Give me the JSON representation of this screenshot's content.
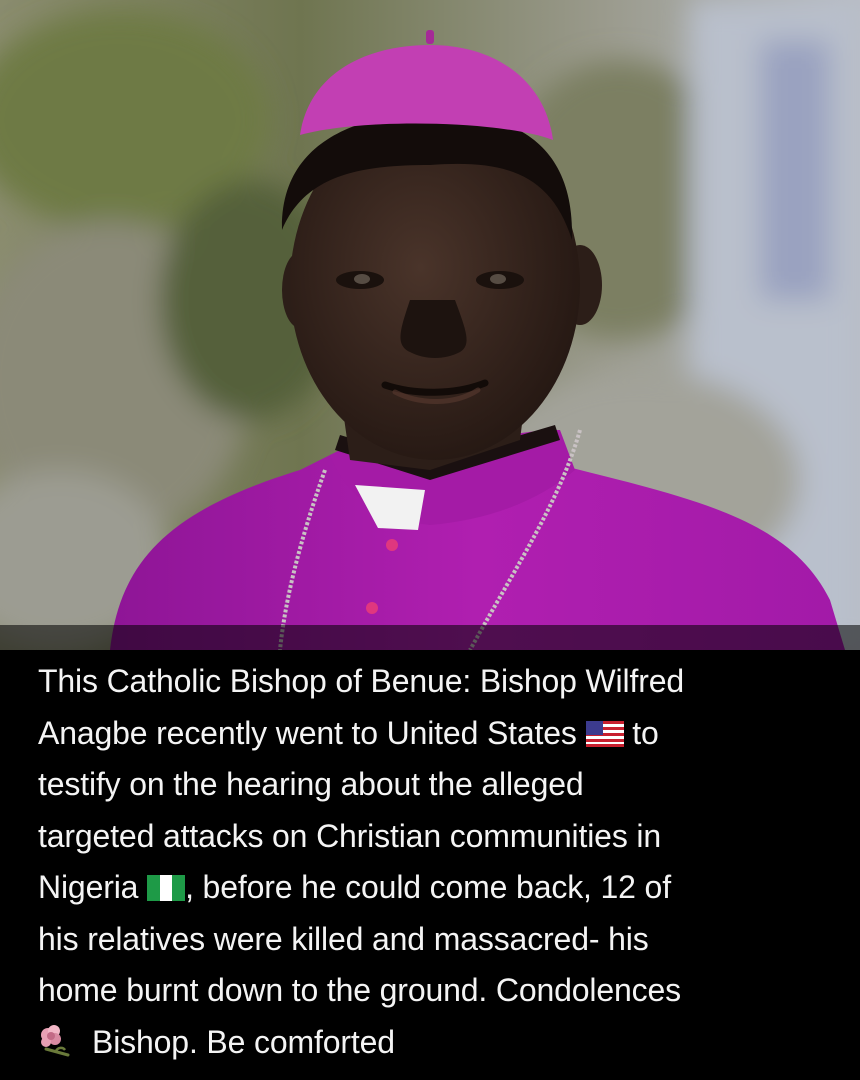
{
  "photo": {
    "subject": "bishop-portrait",
    "colors": {
      "vestment": "#a21aa8",
      "zucchetto": "#c23fb3",
      "background": "#7a7e5e",
      "skin": "#3b2a22"
    }
  },
  "caption": {
    "line1": "This Catholic Bishop of Benue: Bishop Wilfred",
    "line2_a": "Anagbe recently went to United States",
    "line2_b": " to",
    "line3": "testify on the hearing about  the alleged",
    "line4": "targeted attacks on Christian communities in",
    "line5_a": "Nigeria",
    "line5_b": ", before he could come back, 12 of",
    "line6": "his relatives were killed and massacred- his",
    "line7": "home burnt down to the ground. Condolences",
    "line8": "Bishop. Be comforted"
  },
  "emoji": {
    "us_flag": "us-flag-icon",
    "nigeria_flag": "nigeria-flag-icon",
    "flower": "wilted-flower-icon"
  },
  "colors": {
    "caption_background": "#000000",
    "caption_text": "#f4f4f4"
  }
}
